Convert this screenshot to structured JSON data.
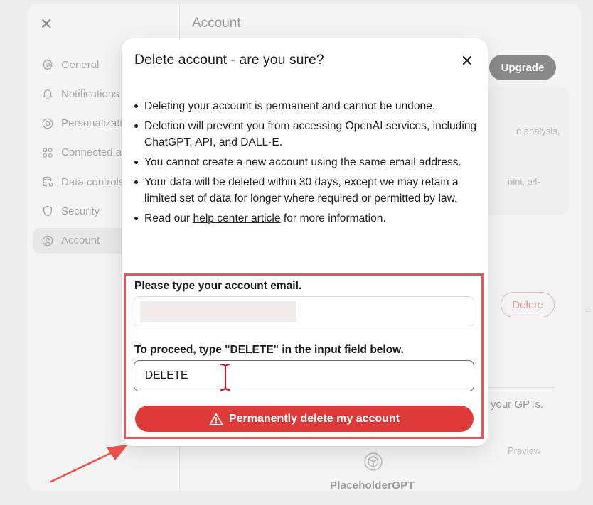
{
  "background": {
    "sidebar": {
      "items": [
        {
          "label": "General",
          "icon": "gear-icon"
        },
        {
          "label": "Notifications",
          "icon": "bell-icon"
        },
        {
          "label": "Personalization",
          "icon": "personalization-icon"
        },
        {
          "label": "Connected apps",
          "icon": "apps-icon"
        },
        {
          "label": "Data controls",
          "icon": "database-icon"
        },
        {
          "label": "Security",
          "icon": "shield-icon"
        },
        {
          "label": "Account",
          "icon": "user-circle-icon",
          "active": true
        }
      ]
    },
    "main": {
      "title": "Account",
      "upgrade_label": "Upgrade",
      "text_fragment_1": "n analysis,",
      "text_fragment_2": "nini, o4-",
      "delete_label": "Delete",
      "gpts_text": "your GPTs.",
      "preview_label": "Preview",
      "placeholder_gpt": "PlaceholderGPT"
    }
  },
  "modal": {
    "title": "Delete account - are you sure?",
    "bullets": [
      "Deleting your account is permanent and cannot be undone.",
      "Deletion will prevent you from accessing OpenAI services, including ChatGPT, API, and DALL·E.",
      "You cannot create a new account using the same email address.",
      "Your data will be deleted within 30 days, except we may retain a limited set of data for longer where required or permitted by law."
    ],
    "help": {
      "prefix": "Read our ",
      "link": "help center article",
      "suffix": " for more information."
    },
    "email_label": "Please type your account email.",
    "email_value": "",
    "confirm_label": "To proceed, type \"DELETE\" in the input field below.",
    "confirm_value": "DELETE",
    "delete_button": "Permanently delete my account"
  },
  "colors": {
    "danger": "#df3a3a",
    "highlight": "#e05a5a",
    "arrow": "#e8504a"
  }
}
